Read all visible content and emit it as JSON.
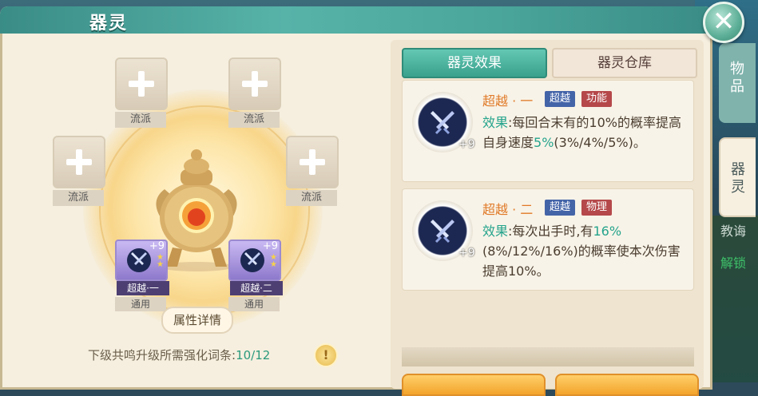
{
  "window": {
    "title": "器灵",
    "close_icon": "close-icon"
  },
  "left": {
    "slots": [
      {
        "label": "流派"
      },
      {
        "label": "流派"
      },
      {
        "label": "流派"
      },
      {
        "label": "流派"
      }
    ],
    "equipped": [
      {
        "name": "超越·一",
        "level": "+9",
        "label": "通用"
      },
      {
        "name": "超越·二",
        "level": "+9",
        "label": "通用"
      }
    ],
    "detail_button": "属性详情",
    "requirement_text": "下级共鸣升级所需强化词条:",
    "requirement_value": "10/12",
    "warning_glyph": "!"
  },
  "right": {
    "tabs": [
      {
        "label": "器灵效果",
        "active": true
      },
      {
        "label": "器灵仓库",
        "active": false
      }
    ],
    "cards": [
      {
        "title": "超越 · 一",
        "badges": [
          "超越",
          "功能"
        ],
        "level": "+9",
        "effect_prefix": "效果",
        "effect_pre": ":每回合末有的10%的概率提高自身速度",
        "effect_highlight": "5%",
        "effect_post": "(3%/4%/5%)。"
      },
      {
        "title": "超越 · 二",
        "badges": [
          "超越",
          "物理"
        ],
        "level": "+9",
        "effect_prefix": "效果",
        "effect_pre": ":每次出手时,有",
        "effect_highlight": "16%",
        "effect_post": "(8%/12%/16%)的概率使本次伤害提高10%。"
      }
    ]
  },
  "side_tabs": [
    {
      "label": "物品"
    },
    {
      "label": "器灵"
    }
  ],
  "side_background_text": [
    "教诲",
    "解锁"
  ],
  "colors": {
    "accent": "#3aa18d",
    "highlight": "#25a48c",
    "title_orange": "#e07a28"
  }
}
